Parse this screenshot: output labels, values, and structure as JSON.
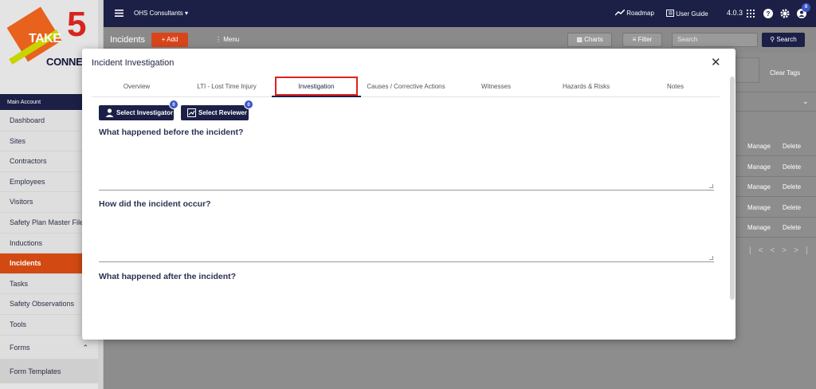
{
  "app": {
    "workspace_label": "OHS Consultants",
    "roadmap_label": "Roadmap",
    "user_guide_label": "User Guide",
    "version": "4.0.3",
    "notification_count": "0"
  },
  "logo": {
    "take": "TAKE",
    "five": "5",
    "connect": "CONNEC"
  },
  "sidebar": {
    "header": "Main Account",
    "items": [
      {
        "label": "Dashboard"
      },
      {
        "label": "Sites"
      },
      {
        "label": "Contractors"
      },
      {
        "label": "Employees"
      },
      {
        "label": "Visitors"
      },
      {
        "label": "Safety Plan Master File"
      },
      {
        "label": "Inductions"
      },
      {
        "label": "Incidents"
      },
      {
        "label": "Tasks"
      },
      {
        "label": "Safety Observations"
      },
      {
        "label": "Tools"
      }
    ],
    "forms_label": "Forms",
    "form_templates_label": "Form Templates"
  },
  "page": {
    "title": "Incidents",
    "add_label": "Add",
    "menu_label": "Menu",
    "charts_label": "Charts",
    "filter_label": "Filter",
    "search_placeholder": "Search",
    "search_button": "Search",
    "clear_tags_label": "Clear Tags",
    "rows": [
      {
        "manage": "Manage",
        "delete": "Delete"
      },
      {
        "manage": "Manage",
        "delete": "Delete"
      },
      {
        "manage": "Manage",
        "delete": "Delete"
      },
      {
        "manage": "Manage",
        "delete": "Delete"
      },
      {
        "manage": "Manage",
        "delete": "Delete"
      }
    ]
  },
  "modal": {
    "title": "Incident Investigation",
    "tabs": [
      {
        "label": "Overview"
      },
      {
        "label": "LTI - Lost Time Injury"
      },
      {
        "label": "Investigation"
      },
      {
        "label": "Causes / Corrective Actions"
      },
      {
        "label": "Witnesses"
      },
      {
        "label": "Hazards & Risks"
      },
      {
        "label": "Notes"
      }
    ],
    "select_investigator_label": "Select Investigator",
    "select_investigator_count": "0",
    "select_reviewer_label": "Select Reviewer",
    "select_reviewer_count": "0",
    "questions": [
      {
        "label": "What happened before the incident?",
        "value": ""
      },
      {
        "label": "How did the incident occur?",
        "value": ""
      },
      {
        "label": "What happened after the incident?",
        "value": ""
      }
    ]
  },
  "colors": {
    "navy": "#1c2046",
    "accent_orange": "#d9451a",
    "highlight_red": "#e02020",
    "badge_blue": "#3d56c8"
  }
}
